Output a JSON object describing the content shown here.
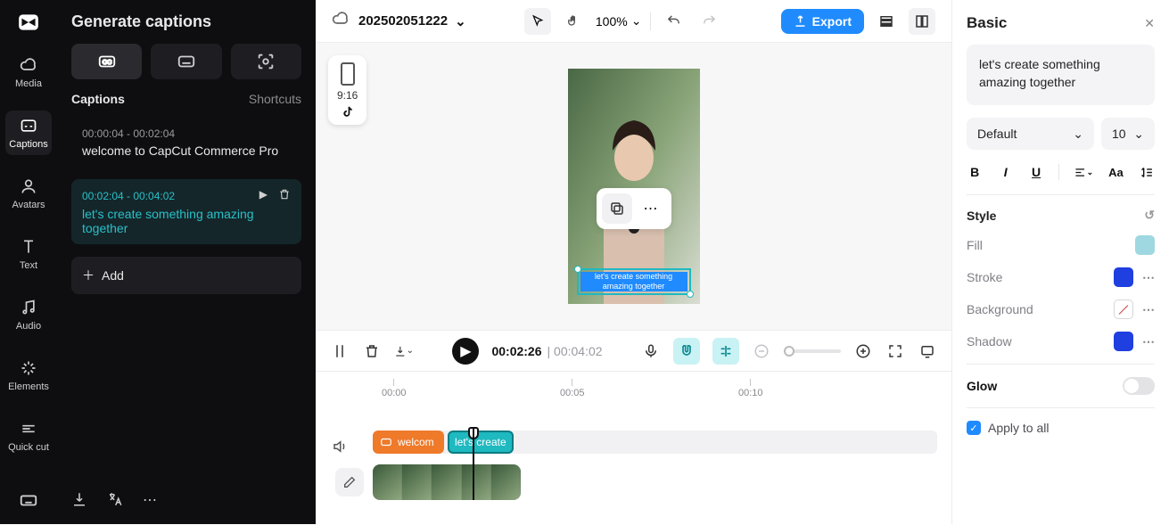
{
  "rail": {
    "items": [
      {
        "label": "Media"
      },
      {
        "label": "Captions"
      },
      {
        "label": "Avatars"
      },
      {
        "label": "Text"
      },
      {
        "label": "Audio"
      },
      {
        "label": "Elements"
      },
      {
        "label": "Quick cut"
      }
    ]
  },
  "panel": {
    "title": "Generate captions",
    "captions_label": "Captions",
    "shortcuts_label": "Shortcuts",
    "items": [
      {
        "time": "00:00:04 - 00:02:04",
        "text": "welcome to CapCut Commerce Pro"
      },
      {
        "time": "00:02:04 - 00:04:02",
        "text": "let's create something amazing together"
      }
    ],
    "add_label": "Add"
  },
  "topbar": {
    "project": "202502051222",
    "zoom": "100%",
    "export": "Export"
  },
  "preview": {
    "ratio": "9:16",
    "caption": "let's create something amazing together"
  },
  "controls": {
    "current": "00:02:26",
    "duration": "00:04:02"
  },
  "timeline": {
    "ticks": [
      "00:00",
      "00:05",
      "00:10"
    ],
    "clip1": "welcom",
    "clip2": "let's create"
  },
  "basic": {
    "title": "Basic",
    "text": "let's create something amazing together",
    "font": "Default",
    "size": "10",
    "style_label": "Style",
    "fill_label": "Fill",
    "stroke_label": "Stroke",
    "background_label": "Background",
    "shadow_label": "Shadow",
    "glow_label": "Glow",
    "apply_label": "Apply to all",
    "colors": {
      "fill": "#9fd8e0",
      "stroke": "#1f3fe0",
      "shadow": "#1f3fe0"
    }
  }
}
